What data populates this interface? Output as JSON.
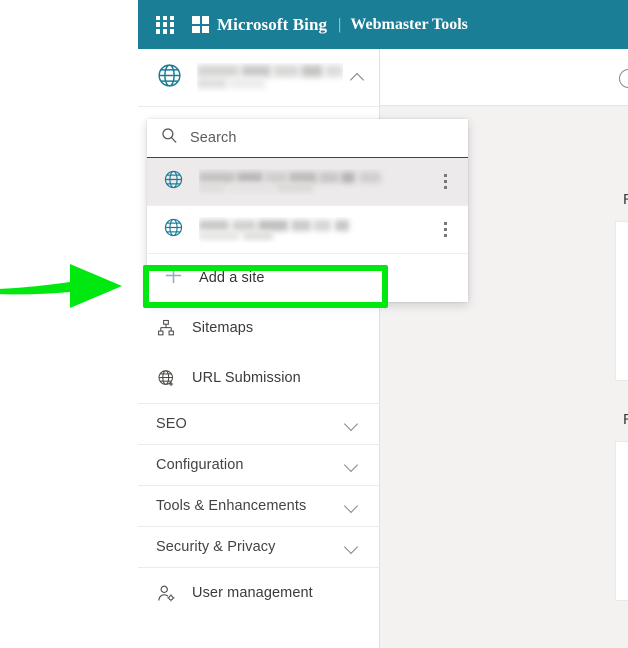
{
  "header": {
    "waffle_icon": "waffle-grid-icon",
    "logo_icon": "microsoft-logo-icon",
    "brand": "Microsoft Bing",
    "separator": "|",
    "product": "Webmaster Tools",
    "background_color": "#1a7e96"
  },
  "site_selector": {
    "globe_icon": "globe-icon",
    "site_name": "",
    "site_name_redacted": true,
    "chevron_icon": "chevron-up-icon",
    "expanded": true
  },
  "dropdown": {
    "search": {
      "icon": "search-icon",
      "placeholder": "Search",
      "value": ""
    },
    "sites": [
      {
        "icon": "globe-icon",
        "name": "",
        "redacted": true,
        "hovered": true,
        "menu_icon": "more-vertical-icon"
      },
      {
        "icon": "globe-icon",
        "name": "",
        "redacted": true,
        "hovered": false,
        "menu_icon": "more-vertical-icon"
      }
    ],
    "add_site": {
      "icon": "plus-icon",
      "label": "Add a site"
    }
  },
  "sidebar": {
    "items": [
      {
        "label": "Sitemaps",
        "icon": "sitemap-icon",
        "type": "link"
      },
      {
        "label": "URL Submission",
        "icon": "globe-plus-icon",
        "type": "link"
      },
      {
        "label": "SEO",
        "icon": "chevron-down-icon",
        "type": "section"
      },
      {
        "label": "Configuration",
        "icon": "chevron-down-icon",
        "type": "section"
      },
      {
        "label": "Tools & Enhancements",
        "icon": "chevron-down-icon",
        "type": "section"
      },
      {
        "label": "Security & Privacy",
        "icon": "chevron-down-icon",
        "type": "section"
      },
      {
        "label": "User management",
        "icon": "user-gear-icon",
        "type": "link"
      }
    ]
  },
  "content": {
    "help_icon": "help-circle-icon",
    "heading_1": "R",
    "heading_2": "R",
    "background_color": "#f3f2f1"
  },
  "annotations": {
    "arrow": {
      "icon": "arrow-right-annotation",
      "color": "#00e810",
      "points_to": "Add a site"
    },
    "highlight_box": {
      "color": "#00e810",
      "target": "Add a site"
    }
  },
  "colors": {
    "header_teal": "#1a7e96",
    "globe_teal": "#1a7b96",
    "annotation_green": "#00e810",
    "content_gray": "#f3f2f1",
    "plus_blue": "#8aafc4"
  }
}
